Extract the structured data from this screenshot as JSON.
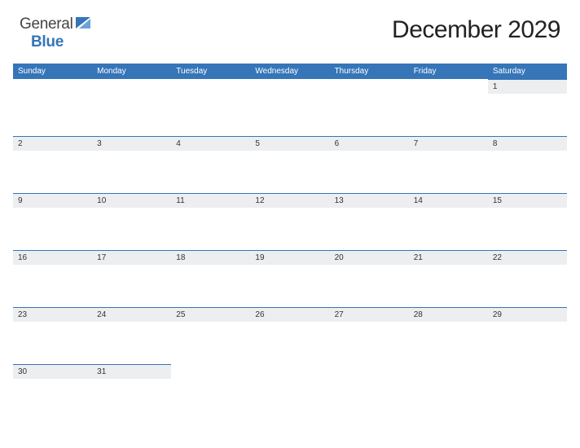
{
  "logo": {
    "part1": "General",
    "part2": "Blue"
  },
  "title": "December 2029",
  "weekdays": [
    "Sunday",
    "Monday",
    "Tuesday",
    "Wednesday",
    "Thursday",
    "Friday",
    "Saturday"
  ],
  "weeks": [
    [
      "",
      "",
      "",
      "",
      "",
      "",
      "1"
    ],
    [
      "2",
      "3",
      "4",
      "5",
      "6",
      "7",
      "8"
    ],
    [
      "9",
      "10",
      "11",
      "12",
      "13",
      "14",
      "15"
    ],
    [
      "16",
      "17",
      "18",
      "19",
      "20",
      "21",
      "22"
    ],
    [
      "23",
      "24",
      "25",
      "26",
      "27",
      "28",
      "29"
    ],
    [
      "30",
      "31",
      "",
      "",
      "",
      "",
      ""
    ]
  ]
}
